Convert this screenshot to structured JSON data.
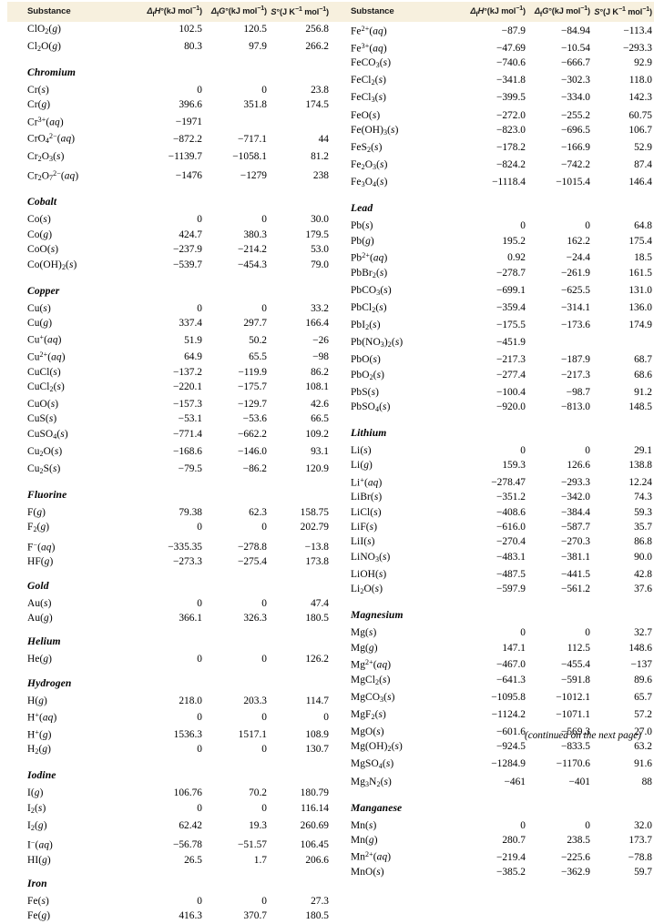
{
  "header": {
    "substance": "Substance",
    "dh": "Δ₁H°(kJ mol⁻¹)",
    "dg": "Δ₁G°(kJ mol⁻¹)",
    "s": "S°(J K⁻¹ mol⁻¹)"
  },
  "footer": {
    "note": "(continued on the next page)"
  },
  "left_column": [
    {
      "type": "row",
      "formula_html": "ClO<sub>2</sub>(<i>g</i>)",
      "dh": "102.5",
      "dg": "120.5",
      "s": "256.8"
    },
    {
      "type": "row",
      "formula_html": "Cl<sub>2</sub>O(<i>g</i>)",
      "dh": "80.3",
      "dg": "97.9",
      "s": "266.2"
    },
    {
      "type": "section",
      "title": "Chromium"
    },
    {
      "type": "row",
      "formula_html": "Cr(<i>s</i>)",
      "dh": "0",
      "dg": "0",
      "s": "23.8"
    },
    {
      "type": "row",
      "formula_html": "Cr(<i>g</i>)",
      "dh": "396.6",
      "dg": "351.8",
      "s": "174.5"
    },
    {
      "type": "row",
      "formula_html": "Cr<sup>3+</sup>(<i>aq</i>)",
      "dh": "−1971",
      "dg": "",
      "s": ""
    },
    {
      "type": "row",
      "formula_html": "CrO<sub>4</sub><sup>2−</sup>(<i>aq</i>)",
      "dh": "−872.2",
      "dg": "−717.1",
      "s": "44"
    },
    {
      "type": "row",
      "formula_html": "Cr<sub>2</sub>O<sub>3</sub>(<i>s</i>)",
      "dh": "−1139.7",
      "dg": "−1058.1",
      "s": "81.2"
    },
    {
      "type": "row",
      "formula_html": "Cr<sub>2</sub>O<sub>7</sub><sup>2−</sup>(<i>aq</i>)",
      "dh": "−1476",
      "dg": "−1279",
      "s": "238"
    },
    {
      "type": "section",
      "title": "Cobalt"
    },
    {
      "type": "row",
      "formula_html": "Co(<i>s</i>)",
      "dh": "0",
      "dg": "0",
      "s": "30.0"
    },
    {
      "type": "row",
      "formula_html": "Co(<i>g</i>)",
      "dh": "424.7",
      "dg": "380.3",
      "s": "179.5"
    },
    {
      "type": "row",
      "formula_html": "CoO(<i>s</i>)",
      "dh": "−237.9",
      "dg": "−214.2",
      "s": "53.0"
    },
    {
      "type": "row",
      "formula_html": "Co(OH)<sub>2</sub>(<i>s</i>)",
      "dh": "−539.7",
      "dg": "−454.3",
      "s": "79.0"
    },
    {
      "type": "section",
      "title": "Copper"
    },
    {
      "type": "row",
      "formula_html": "Cu(<i>s</i>)",
      "dh": "0",
      "dg": "0",
      "s": "33.2"
    },
    {
      "type": "row",
      "formula_html": "Cu(<i>g</i>)",
      "dh": "337.4",
      "dg": "297.7",
      "s": "166.4"
    },
    {
      "type": "row",
      "formula_html": "Cu<sup>+</sup>(<i>aq</i>)",
      "dh": "51.9",
      "dg": "50.2",
      "s": "−26"
    },
    {
      "type": "row",
      "formula_html": "Cu<sup>2+</sup>(<i>aq</i>)",
      "dh": "64.9",
      "dg": "65.5",
      "s": "−98"
    },
    {
      "type": "row",
      "formula_html": "CuCl(<i>s</i>)",
      "dh": "−137.2",
      "dg": "−119.9",
      "s": "86.2"
    },
    {
      "type": "row",
      "formula_html": "CuCl<sub>2</sub>(<i>s</i>)",
      "dh": "−220.1",
      "dg": "−175.7",
      "s": "108.1"
    },
    {
      "type": "row",
      "formula_html": "CuO(<i>s</i>)",
      "dh": "−157.3",
      "dg": "−129.7",
      "s": "42.6"
    },
    {
      "type": "row",
      "formula_html": "CuS(<i>s</i>)",
      "dh": "−53.1",
      "dg": "−53.6",
      "s": "66.5"
    },
    {
      "type": "row",
      "formula_html": "CuSO<sub>4</sub>(<i>s</i>)",
      "dh": "−771.4",
      "dg": "−662.2",
      "s": "109.2"
    },
    {
      "type": "row",
      "formula_html": "Cu<sub>2</sub>O(<i>s</i>)",
      "dh": "−168.6",
      "dg": "−146.0",
      "s": "93.1"
    },
    {
      "type": "row",
      "formula_html": "Cu<sub>2</sub>S(<i>s</i>)",
      "dh": "−79.5",
      "dg": "−86.2",
      "s": "120.9"
    },
    {
      "type": "section",
      "title": "Fluorine"
    },
    {
      "type": "row",
      "formula_html": "F(<i>g</i>)",
      "dh": "79.38",
      "dg": "62.3",
      "s": "158.75"
    },
    {
      "type": "row",
      "formula_html": "F<sub>2</sub>(<i>g</i>)",
      "dh": "0",
      "dg": "0",
      "s": "202.79"
    },
    {
      "type": "row",
      "formula_html": "F<sup>−</sup>(<i>aq</i>)",
      "dh": "−335.35",
      "dg": "−278.8",
      "s": "−13.8"
    },
    {
      "type": "row",
      "formula_html": "HF(<i>g</i>)",
      "dh": "−273.3",
      "dg": "−275.4",
      "s": "173.8"
    },
    {
      "type": "section",
      "title": "Gold"
    },
    {
      "type": "row",
      "formula_html": "Au(<i>s</i>)",
      "dh": "0",
      "dg": "0",
      "s": "47.4"
    },
    {
      "type": "row",
      "formula_html": "Au(<i>g</i>)",
      "dh": "366.1",
      "dg": "326.3",
      "s": "180.5"
    },
    {
      "type": "section",
      "title": "Helium"
    },
    {
      "type": "row",
      "formula_html": "He(<i>g</i>)",
      "dh": "0",
      "dg": "0",
      "s": "126.2"
    },
    {
      "type": "section",
      "title": "Hydrogen"
    },
    {
      "type": "row",
      "formula_html": "H(<i>g</i>)",
      "dh": "218.0",
      "dg": "203.3",
      "s": "114.7"
    },
    {
      "type": "row",
      "formula_html": "H<sup>+</sup>(<i>aq</i>)",
      "dh": "0",
      "dg": "0",
      "s": "0"
    },
    {
      "type": "row",
      "formula_html": "H<sup>+</sup>(<i>g</i>)",
      "dh": "1536.3",
      "dg": "1517.1",
      "s": "108.9"
    },
    {
      "type": "row",
      "formula_html": "H<sub>2</sub>(<i>g</i>)",
      "dh": "0",
      "dg": "0",
      "s": "130.7"
    },
    {
      "type": "section",
      "title": "Iodine"
    },
    {
      "type": "row",
      "formula_html": "I(<i>g</i>)",
      "dh": "106.76",
      "dg": "70.2",
      "s": "180.79"
    },
    {
      "type": "row",
      "formula_html": "I<sub>2</sub>(<i>s</i>)",
      "dh": "0",
      "dg": "0",
      "s": "116.14"
    },
    {
      "type": "row",
      "formula_html": "I<sub>2</sub>(<i>g</i>)",
      "dh": "62.42",
      "dg": "19.3",
      "s": "260.69"
    },
    {
      "type": "row",
      "formula_html": "I<sup>−</sup>(<i>aq</i>)",
      "dh": "−56.78",
      "dg": "−51.57",
      "s": "106.45"
    },
    {
      "type": "row",
      "formula_html": "HI(<i>g</i>)",
      "dh": "26.5",
      "dg": "1.7",
      "s": "206.6"
    },
    {
      "type": "section",
      "title": "Iron"
    },
    {
      "type": "row",
      "formula_html": "Fe(<i>s</i>)",
      "dh": "0",
      "dg": "0",
      "s": "27.3"
    },
    {
      "type": "row",
      "formula_html": "Fe(<i>g</i>)",
      "dh": "416.3",
      "dg": "370.7",
      "s": "180.5"
    }
  ],
  "right_column": [
    {
      "type": "row",
      "formula_html": "Fe<sup>2+</sup>(<i>aq</i>)",
      "dh": "−87.9",
      "dg": "−84.94",
      "s": "−113.4"
    },
    {
      "type": "row",
      "formula_html": "Fe<sup>3+</sup>(<i>aq</i>)",
      "dh": "−47.69",
      "dg": "−10.54",
      "s": "−293.3"
    },
    {
      "type": "row",
      "formula_html": "FeCO<sub>3</sub>(<i>s</i>)",
      "dh": "−740.6",
      "dg": "−666.7",
      "s": "92.9"
    },
    {
      "type": "row",
      "formula_html": "FeCl<sub>2</sub>(<i>s</i>)",
      "dh": "−341.8",
      "dg": "−302.3",
      "s": "118.0"
    },
    {
      "type": "row",
      "formula_html": "FeCl<sub>3</sub>(<i>s</i>)",
      "dh": "−399.5",
      "dg": "−334.0",
      "s": "142.3"
    },
    {
      "type": "row",
      "formula_html": "FeO(<i>s</i>)",
      "dh": "−272.0",
      "dg": "−255.2",
      "s": "60.75"
    },
    {
      "type": "row",
      "formula_html": "Fe(OH)<sub>3</sub>(<i>s</i>)",
      "dh": "−823.0",
      "dg": "−696.5",
      "s": "106.7"
    },
    {
      "type": "row",
      "formula_html": "FeS<sub>2</sub>(<i>s</i>)",
      "dh": "−178.2",
      "dg": "−166.9",
      "s": "52.9"
    },
    {
      "type": "row",
      "formula_html": "Fe<sub>2</sub>O<sub>3</sub>(<i>s</i>)",
      "dh": "−824.2",
      "dg": "−742.2",
      "s": "87.4"
    },
    {
      "type": "row",
      "formula_html": "Fe<sub>3</sub>O<sub>4</sub>(<i>s</i>)",
      "dh": "−1118.4",
      "dg": "−1015.4",
      "s": "146.4"
    },
    {
      "type": "section",
      "title": "Lead"
    },
    {
      "type": "row",
      "formula_html": "Pb(<i>s</i>)",
      "dh": "0",
      "dg": "0",
      "s": "64.8"
    },
    {
      "type": "row",
      "formula_html": "Pb(<i>g</i>)",
      "dh": "195.2",
      "dg": "162.2",
      "s": "175.4"
    },
    {
      "type": "row",
      "formula_html": "Pb<sup>2+</sup>(<i>aq</i>)",
      "dh": "0.92",
      "dg": "−24.4",
      "s": "18.5"
    },
    {
      "type": "row",
      "formula_html": "PbBr<sub>2</sub>(<i>s</i>)",
      "dh": "−278.7",
      "dg": "−261.9",
      "s": "161.5"
    },
    {
      "type": "row",
      "formula_html": "PbCO<sub>3</sub>(<i>s</i>)",
      "dh": "−699.1",
      "dg": "−625.5",
      "s": "131.0"
    },
    {
      "type": "row",
      "formula_html": "PbCl<sub>2</sub>(<i>s</i>)",
      "dh": "−359.4",
      "dg": "−314.1",
      "s": "136.0"
    },
    {
      "type": "row",
      "formula_html": "PbI<sub>2</sub>(<i>s</i>)",
      "dh": "−175.5",
      "dg": "−173.6",
      "s": "174.9"
    },
    {
      "type": "row",
      "formula_html": "Pb(NO<sub>3</sub>)<sub>2</sub>(<i>s</i>)",
      "dh": "−451.9",
      "dg": "",
      "s": ""
    },
    {
      "type": "row",
      "formula_html": "PbO(<i>s</i>)",
      "dh": "−217.3",
      "dg": "−187.9",
      "s": "68.7"
    },
    {
      "type": "row",
      "formula_html": "PbO<sub>2</sub>(<i>s</i>)",
      "dh": "−277.4",
      "dg": "−217.3",
      "s": "68.6"
    },
    {
      "type": "row",
      "formula_html": "PbS(<i>s</i>)",
      "dh": "−100.4",
      "dg": "−98.7",
      "s": "91.2"
    },
    {
      "type": "row",
      "formula_html": "PbSO<sub>4</sub>(<i>s</i>)",
      "dh": "−920.0",
      "dg": "−813.0",
      "s": "148.5"
    },
    {
      "type": "section",
      "title": "Lithium"
    },
    {
      "type": "row",
      "formula_html": "Li(<i>s</i>)",
      "dh": "0",
      "dg": "0",
      "s": "29.1"
    },
    {
      "type": "row",
      "formula_html": "Li(<i>g</i>)",
      "dh": "159.3",
      "dg": "126.6",
      "s": "138.8"
    },
    {
      "type": "row",
      "formula_html": "Li<sup>+</sup>(<i>aq</i>)",
      "dh": "−278.47",
      "dg": "−293.3",
      "s": "12.24"
    },
    {
      "type": "row",
      "formula_html": "LiBr(<i>s</i>)",
      "dh": "−351.2",
      "dg": "−342.0",
      "s": "74.3"
    },
    {
      "type": "row",
      "formula_html": "LiCl(<i>s</i>)",
      "dh": "−408.6",
      "dg": "−384.4",
      "s": "59.3"
    },
    {
      "type": "row",
      "formula_html": "LiF(<i>s</i>)",
      "dh": "−616.0",
      "dg": "−587.7",
      "s": "35.7"
    },
    {
      "type": "row",
      "formula_html": "LiI(<i>s</i>)",
      "dh": "−270.4",
      "dg": "−270.3",
      "s": "86.8"
    },
    {
      "type": "row",
      "formula_html": "LiNO<sub>3</sub>(<i>s</i>)",
      "dh": "−483.1",
      "dg": "−381.1",
      "s": "90.0"
    },
    {
      "type": "row",
      "formula_html": "LiOH(<i>s</i>)",
      "dh": "−487.5",
      "dg": "−441.5",
      "s": "42.8"
    },
    {
      "type": "row",
      "formula_html": "Li<sub>2</sub>O(<i>s</i>)",
      "dh": "−597.9",
      "dg": "−561.2",
      "s": "37.6"
    },
    {
      "type": "section",
      "title": "Magnesium"
    },
    {
      "type": "row",
      "formula_html": "Mg(<i>s</i>)",
      "dh": "0",
      "dg": "0",
      "s": "32.7"
    },
    {
      "type": "row",
      "formula_html": "Mg(<i>g</i>)",
      "dh": "147.1",
      "dg": "112.5",
      "s": "148.6"
    },
    {
      "type": "row",
      "formula_html": "Mg<sup>2+</sup>(<i>aq</i>)",
      "dh": "−467.0",
      "dg": "−455.4",
      "s": "−137"
    },
    {
      "type": "row",
      "formula_html": "MgCl<sub>2</sub>(<i>s</i>)",
      "dh": "−641.3",
      "dg": "−591.8",
      "s": "89.6"
    },
    {
      "type": "row",
      "formula_html": "MgCO<sub>3</sub>(<i>s</i>)",
      "dh": "−1095.8",
      "dg": "−1012.1",
      "s": "65.7"
    },
    {
      "type": "row",
      "formula_html": "MgF<sub>2</sub>(<i>s</i>)",
      "dh": "−1124.2",
      "dg": "−1071.1",
      "s": "57.2"
    },
    {
      "type": "row",
      "formula_html": "MgO(<i>s</i>)",
      "dh": "−601.6",
      "dg": "−569.3",
      "s": "27.0"
    },
    {
      "type": "row",
      "formula_html": "Mg(OH)<sub>2</sub>(<i>s</i>)",
      "dh": "−924.5",
      "dg": "−833.5",
      "s": "63.2"
    },
    {
      "type": "row",
      "formula_html": "MgSO<sub>4</sub>(<i>s</i>)",
      "dh": "−1284.9",
      "dg": "−1170.6",
      "s": "91.6"
    },
    {
      "type": "row",
      "formula_html": "Mg<sub>3</sub>N<sub>2</sub>(<i>s</i>)",
      "dh": "−461",
      "dg": "−401",
      "s": "88"
    },
    {
      "type": "section",
      "title": "Manganese"
    },
    {
      "type": "row",
      "formula_html": "Mn(<i>s</i>)",
      "dh": "0",
      "dg": "0",
      "s": "32.0"
    },
    {
      "type": "row",
      "formula_html": "Mn(<i>g</i>)",
      "dh": "280.7",
      "dg": "238.5",
      "s": "173.7"
    },
    {
      "type": "row",
      "formula_html": "Mn<sup>2+</sup>(<i>aq</i>)",
      "dh": "−219.4",
      "dg": "−225.6",
      "s": "−78.8"
    },
    {
      "type": "row",
      "formula_html": "MnO(<i>s</i>)",
      "dh": "−385.2",
      "dg": "−362.9",
      "s": "59.7"
    }
  ]
}
